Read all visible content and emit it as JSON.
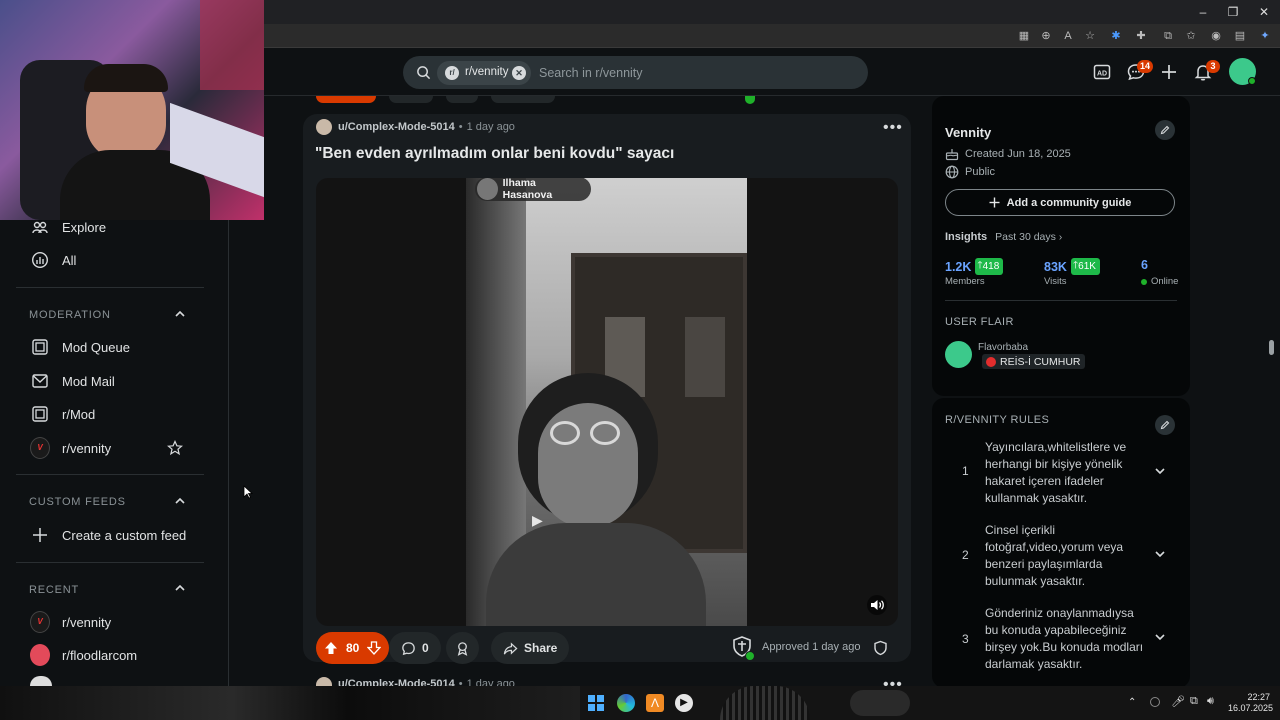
{
  "header": {
    "search_chip": "r/vennity",
    "search_placeholder": "Search in r/vennity",
    "chat_badge": "14",
    "notif_badge": "3"
  },
  "sidebar": {
    "top_items": [
      {
        "label": "Explore",
        "icon": "explore-icon"
      },
      {
        "label": "All",
        "icon": "all-icon"
      }
    ],
    "moderation": {
      "title": "MODERATION",
      "items": [
        {
          "label": "Mod Queue",
          "icon": "mod-queue-icon"
        },
        {
          "label": "Mod Mail",
          "icon": "mod-mail-icon"
        },
        {
          "label": "r/Mod",
          "icon": "mod-icon"
        },
        {
          "label": "r/vennity",
          "icon": "vennity-avatar"
        }
      ]
    },
    "custom_feeds": {
      "title": "CUSTOM FEEDS",
      "create_label": "Create a custom feed"
    },
    "recent": {
      "title": "RECENT",
      "items": [
        {
          "label": "r/vennity"
        },
        {
          "label": "r/floodlarcom"
        }
      ]
    }
  },
  "post": {
    "author": "u/Complex-Mode-5014",
    "time": "1 day ago",
    "title": "\"Ben evden ayrılmadım onlar beni kovdu\" sayacı",
    "video_overlay_user": "Ilhama Hasanova",
    "votes": "80",
    "comments": "0",
    "share_label": "Share",
    "approved_text": "Approved 1 day ago"
  },
  "next_post": {
    "author": "u/Complex-Mode-5014",
    "time": "1 day ago"
  },
  "community": {
    "name": "Vennity",
    "created": "Created Jun 18, 2025",
    "visibility": "Public",
    "guide_button": "Add a community guide",
    "insights_label": "Insights",
    "insights_period": "Past 30 days",
    "stats": [
      {
        "value": "1.2K",
        "delta": "418",
        "label": "Members"
      },
      {
        "value": "83K",
        "delta": "61K",
        "label": "Visits"
      },
      {
        "value": "6",
        "label": "Online"
      }
    ],
    "user_flair_title": "USER FLAIR",
    "flair_user": "Flavorbaba",
    "flair_text": "REİS-İ CUMHUR"
  },
  "rules": {
    "title": "R/VENNITY RULES",
    "items": [
      {
        "num": "1",
        "text": "Yayıncılara,whitelistlere ve herhangi bir kişiye yönelik hakaret içeren ifadeler kullanmak yasaktır."
      },
      {
        "num": "2",
        "text": "Cinsel içerikli fotoğraf,video,yorum veya benzeri paylaşımlarda bulunmak yasaktır."
      },
      {
        "num": "3",
        "text": "Gönderiniz onaylanmadıysa bu konuda yapabileceğiniz birşey yok.Bu konuda modları darlamak yasaktır."
      }
    ]
  },
  "taskbar": {
    "time": "22:27",
    "date": "16.07.2025"
  },
  "colors": {
    "upvote": "#d93a00",
    "delta_green": "#1eb949",
    "online_green": "#1fb12a",
    "badge": "#d93a00"
  }
}
